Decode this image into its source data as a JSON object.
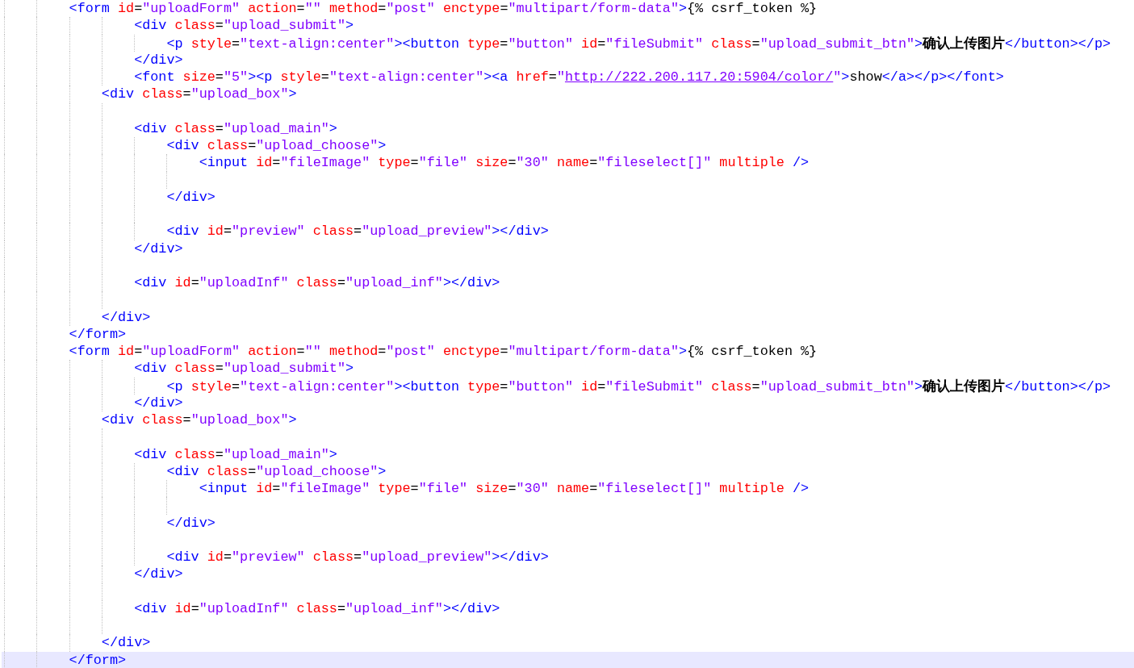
{
  "editor": {
    "lines": [
      {
        "children": [
          {
            "children": [
              {
                "current": false,
                "tokens": [
                  {
                    "kind": "tag",
                    "text": "<form"
                  },
                  {
                    "kind": "attr",
                    "text": " id"
                  },
                  {
                    "kind": "eq",
                    "text": "="
                  },
                  {
                    "kind": "value",
                    "text": "\"uploadForm\""
                  },
                  {
                    "kind": "attr",
                    "text": " action"
                  },
                  {
                    "kind": "eq",
                    "text": "="
                  },
                  {
                    "kind": "value",
                    "text": "\"\""
                  },
                  {
                    "kind": "attr",
                    "text": " method"
                  },
                  {
                    "kind": "eq",
                    "text": "="
                  },
                  {
                    "kind": "value",
                    "text": "\"post\""
                  },
                  {
                    "kind": "attr",
                    "text": " enctype"
                  },
                  {
                    "kind": "eq",
                    "text": "="
                  },
                  {
                    "kind": "value",
                    "text": "\"multipart/form-data\""
                  },
                  {
                    "kind": "tag",
                    "text": ">"
                  },
                  {
                    "kind": "text",
                    "text": "{% csrf_token %}"
                  }
                ],
                "children": [
                  {
                    "children": [
                      {
                        "current": false,
                        "tokens": [
                          {
                            "kind": "tag",
                            "text": "<div"
                          },
                          {
                            "kind": "attr",
                            "text": " class"
                          },
                          {
                            "kind": "eq",
                            "text": "="
                          },
                          {
                            "kind": "value",
                            "text": "\"upload_submit\""
                          },
                          {
                            "kind": "tag",
                            "text": ">"
                          }
                        ],
                        "children": [
                          {
                            "current": false,
                            "tokens": [
                              {
                                "kind": "tag",
                                "text": "<p"
                              },
                              {
                                "kind": "attr",
                                "text": " style"
                              },
                              {
                                "kind": "eq",
                                "text": "="
                              },
                              {
                                "kind": "value",
                                "text": "\"text-align:center\""
                              },
                              {
                                "kind": "tag",
                                "text": "><button"
                              },
                              {
                                "kind": "attr",
                                "text": " type"
                              },
                              {
                                "kind": "eq",
                                "text": "="
                              },
                              {
                                "kind": "value",
                                "text": "\"button\""
                              },
                              {
                                "kind": "attr",
                                "text": " id"
                              },
                              {
                                "kind": "eq",
                                "text": "="
                              },
                              {
                                "kind": "value",
                                "text": "\"fileSubmit\""
                              },
                              {
                                "kind": "attr",
                                "text": " class"
                              },
                              {
                                "kind": "eq",
                                "text": "="
                              },
                              {
                                "kind": "value",
                                "text": "\"upload_submit_btn\""
                              },
                              {
                                "kind": "tag",
                                "text": ">"
                              },
                              {
                                "kind": "cjk",
                                "text": "确认上传图片"
                              },
                              {
                                "kind": "tag",
                                "text": "</button></p>"
                              }
                            ]
                          }
                        ]
                      },
                      {
                        "current": false,
                        "tokens": [
                          {
                            "kind": "tag",
                            "text": "</div>"
                          }
                        ]
                      },
                      {
                        "current": false,
                        "tokens": [
                          {
                            "kind": "tag",
                            "text": "<font"
                          },
                          {
                            "kind": "attr",
                            "text": " size"
                          },
                          {
                            "kind": "eq",
                            "text": "="
                          },
                          {
                            "kind": "value",
                            "text": "\"5\""
                          },
                          {
                            "kind": "tag",
                            "text": "><p"
                          },
                          {
                            "kind": "attr",
                            "text": " style"
                          },
                          {
                            "kind": "eq",
                            "text": "="
                          },
                          {
                            "kind": "value",
                            "text": "\"text-align:center\""
                          },
                          {
                            "kind": "tag",
                            "text": "><a"
                          },
                          {
                            "kind": "attr",
                            "text": " href"
                          },
                          {
                            "kind": "eq",
                            "text": "="
                          },
                          {
                            "kind": "value",
                            "text": "\""
                          },
                          {
                            "kind": "link",
                            "text": "http://222.200.117.20:5904/color/"
                          },
                          {
                            "kind": "value",
                            "text": "\""
                          },
                          {
                            "kind": "tag",
                            "text": ">"
                          },
                          {
                            "kind": "text",
                            "text": "show"
                          },
                          {
                            "kind": "tag",
                            "text": "</a></p></font>"
                          }
                        ]
                      }
                    ]
                  },
                  {
                    "current": false,
                    "tokens": [
                      {
                        "kind": "tag",
                        "text": "<div"
                      },
                      {
                        "kind": "attr",
                        "text": " class"
                      },
                      {
                        "kind": "eq",
                        "text": "="
                      },
                      {
                        "kind": "value",
                        "text": "\"upload_box\""
                      },
                      {
                        "kind": "tag",
                        "text": ">"
                      }
                    ],
                    "children": [
                      {
                        "current": false
                      },
                      {
                        "current": false,
                        "tokens": [
                          {
                            "kind": "tag",
                            "text": "<div"
                          },
                          {
                            "kind": "attr",
                            "text": " class"
                          },
                          {
                            "kind": "eq",
                            "text": "="
                          },
                          {
                            "kind": "value",
                            "text": "\"upload_main\""
                          },
                          {
                            "kind": "tag",
                            "text": ">"
                          }
                        ],
                        "children": [
                          {
                            "current": false,
                            "tokens": [
                              {
                                "kind": "tag",
                                "text": "<div"
                              },
                              {
                                "kind": "attr",
                                "text": " class"
                              },
                              {
                                "kind": "eq",
                                "text": "="
                              },
                              {
                                "kind": "value",
                                "text": "\"upload_choose\""
                              },
                              {
                                "kind": "tag",
                                "text": ">"
                              }
                            ],
                            "children": [
                              {
                                "current": false,
                                "tokens": [
                                  {
                                    "kind": "tag",
                                    "text": "<input"
                                  },
                                  {
                                    "kind": "attr",
                                    "text": " id"
                                  },
                                  {
                                    "kind": "eq",
                                    "text": "="
                                  },
                                  {
                                    "kind": "value",
                                    "text": "\"fileImage\""
                                  },
                                  {
                                    "kind": "attr",
                                    "text": " type"
                                  },
                                  {
                                    "kind": "eq",
                                    "text": "="
                                  },
                                  {
                                    "kind": "value",
                                    "text": "\"file\""
                                  },
                                  {
                                    "kind": "attr",
                                    "text": " size"
                                  },
                                  {
                                    "kind": "eq",
                                    "text": "="
                                  },
                                  {
                                    "kind": "value",
                                    "text": "\"30\""
                                  },
                                  {
                                    "kind": "attr",
                                    "text": " name"
                                  },
                                  {
                                    "kind": "eq",
                                    "text": "="
                                  },
                                  {
                                    "kind": "value",
                                    "text": "\"fileselect[]\""
                                  },
                                  {
                                    "kind": "attr",
                                    "text": " multiple"
                                  },
                                  {
                                    "kind": "tag",
                                    "text": " />"
                                  }
                                ]
                              },
                              {
                                "current": false
                              }
                            ]
                          },
                          {
                            "current": false,
                            "tokens": [
                              {
                                "kind": "tag",
                                "text": "</div>"
                              }
                            ]
                          },
                          {
                            "current": false
                          },
                          {
                            "current": false,
                            "tokens": [
                              {
                                "kind": "tag",
                                "text": "<div"
                              },
                              {
                                "kind": "attr",
                                "text": " id"
                              },
                              {
                                "kind": "eq",
                                "text": "="
                              },
                              {
                                "kind": "value",
                                "text": "\"preview\""
                              },
                              {
                                "kind": "attr",
                                "text": " class"
                              },
                              {
                                "kind": "eq",
                                "text": "="
                              },
                              {
                                "kind": "value",
                                "text": "\"upload_preview\""
                              },
                              {
                                "kind": "tag",
                                "text": "></div>"
                              }
                            ]
                          }
                        ]
                      },
                      {
                        "current": false,
                        "tokens": [
                          {
                            "kind": "tag",
                            "text": "</div>"
                          }
                        ]
                      },
                      {
                        "current": false
                      },
                      {
                        "current": false,
                        "tokens": [
                          {
                            "kind": "tag",
                            "text": "<div"
                          },
                          {
                            "kind": "attr",
                            "text": " id"
                          },
                          {
                            "kind": "eq",
                            "text": "="
                          },
                          {
                            "kind": "value",
                            "text": "\"uploadInf\""
                          },
                          {
                            "kind": "attr",
                            "text": " class"
                          },
                          {
                            "kind": "eq",
                            "text": "="
                          },
                          {
                            "kind": "value",
                            "text": "\"upload_inf\""
                          },
                          {
                            "kind": "tag",
                            "text": "></div>"
                          }
                        ]
                      },
                      {
                        "current": false
                      }
                    ]
                  },
                  {
                    "current": false,
                    "tokens": [
                      {
                        "kind": "tag",
                        "text": "</div>"
                      }
                    ]
                  }
                ]
              },
              {
                "current": false,
                "tokens": [
                  {
                    "kind": "tag",
                    "text": "</form>"
                  }
                ]
              },
              {
                "current": false,
                "tokens": [
                  {
                    "kind": "tag",
                    "text": "<form"
                  },
                  {
                    "kind": "attr",
                    "text": " id"
                  },
                  {
                    "kind": "eq",
                    "text": "="
                  },
                  {
                    "kind": "value",
                    "text": "\"uploadForm\""
                  },
                  {
                    "kind": "attr",
                    "text": " action"
                  },
                  {
                    "kind": "eq",
                    "text": "="
                  },
                  {
                    "kind": "value",
                    "text": "\"\""
                  },
                  {
                    "kind": "attr",
                    "text": " method"
                  },
                  {
                    "kind": "eq",
                    "text": "="
                  },
                  {
                    "kind": "value",
                    "text": "\"post\""
                  },
                  {
                    "kind": "attr",
                    "text": " enctype"
                  },
                  {
                    "kind": "eq",
                    "text": "="
                  },
                  {
                    "kind": "value",
                    "text": "\"multipart/form-data\""
                  },
                  {
                    "kind": "tag",
                    "text": ">"
                  },
                  {
                    "kind": "text",
                    "text": "{% csrf_token %}"
                  }
                ],
                "children": [
                  {
                    "children": [
                      {
                        "current": false,
                        "tokens": [
                          {
                            "kind": "tag",
                            "text": "<div"
                          },
                          {
                            "kind": "attr",
                            "text": " class"
                          },
                          {
                            "kind": "eq",
                            "text": "="
                          },
                          {
                            "kind": "value",
                            "text": "\"upload_submit\""
                          },
                          {
                            "kind": "tag",
                            "text": ">"
                          }
                        ],
                        "children": [
                          {
                            "current": false,
                            "tokens": [
                              {
                                "kind": "tag",
                                "text": "<p"
                              },
                              {
                                "kind": "attr",
                                "text": " style"
                              },
                              {
                                "kind": "eq",
                                "text": "="
                              },
                              {
                                "kind": "value",
                                "text": "\"text-align:center\""
                              },
                              {
                                "kind": "tag",
                                "text": "><button"
                              },
                              {
                                "kind": "attr",
                                "text": " type"
                              },
                              {
                                "kind": "eq",
                                "text": "="
                              },
                              {
                                "kind": "value",
                                "text": "\"button\""
                              },
                              {
                                "kind": "attr",
                                "text": " id"
                              },
                              {
                                "kind": "eq",
                                "text": "="
                              },
                              {
                                "kind": "value",
                                "text": "\"fileSubmit\""
                              },
                              {
                                "kind": "attr",
                                "text": " class"
                              },
                              {
                                "kind": "eq",
                                "text": "="
                              },
                              {
                                "kind": "value",
                                "text": "\"upload_submit_btn\""
                              },
                              {
                                "kind": "tag",
                                "text": ">"
                              },
                              {
                                "kind": "cjk",
                                "text": "确认上传图片"
                              },
                              {
                                "kind": "tag",
                                "text": "</button></p>"
                              }
                            ]
                          }
                        ]
                      },
                      {
                        "current": false,
                        "tokens": [
                          {
                            "kind": "tag",
                            "text": "</div>"
                          }
                        ]
                      }
                    ]
                  },
                  {
                    "current": false,
                    "tokens": [
                      {
                        "kind": "tag",
                        "text": "<div"
                      },
                      {
                        "kind": "attr",
                        "text": " class"
                      },
                      {
                        "kind": "eq",
                        "text": "="
                      },
                      {
                        "kind": "value",
                        "text": "\"upload_box\""
                      },
                      {
                        "kind": "tag",
                        "text": ">"
                      }
                    ],
                    "children": [
                      {
                        "current": false
                      },
                      {
                        "current": false,
                        "tokens": [
                          {
                            "kind": "tag",
                            "text": "<div"
                          },
                          {
                            "kind": "attr",
                            "text": " class"
                          },
                          {
                            "kind": "eq",
                            "text": "="
                          },
                          {
                            "kind": "value",
                            "text": "\"upload_main\""
                          },
                          {
                            "kind": "tag",
                            "text": ">"
                          }
                        ],
                        "children": [
                          {
                            "current": false,
                            "tokens": [
                              {
                                "kind": "tag",
                                "text": "<div"
                              },
                              {
                                "kind": "attr",
                                "text": " class"
                              },
                              {
                                "kind": "eq",
                                "text": "="
                              },
                              {
                                "kind": "value",
                                "text": "\"upload_choose\""
                              },
                              {
                                "kind": "tag",
                                "text": ">"
                              }
                            ],
                            "children": [
                              {
                                "current": false,
                                "tokens": [
                                  {
                                    "kind": "tag",
                                    "text": "<input"
                                  },
                                  {
                                    "kind": "attr",
                                    "text": " id"
                                  },
                                  {
                                    "kind": "eq",
                                    "text": "="
                                  },
                                  {
                                    "kind": "value",
                                    "text": "\"fileImage\""
                                  },
                                  {
                                    "kind": "attr",
                                    "text": " type"
                                  },
                                  {
                                    "kind": "eq",
                                    "text": "="
                                  },
                                  {
                                    "kind": "value",
                                    "text": "\"file\""
                                  },
                                  {
                                    "kind": "attr",
                                    "text": " size"
                                  },
                                  {
                                    "kind": "eq",
                                    "text": "="
                                  },
                                  {
                                    "kind": "value",
                                    "text": "\"30\""
                                  },
                                  {
                                    "kind": "attr",
                                    "text": " name"
                                  },
                                  {
                                    "kind": "eq",
                                    "text": "="
                                  },
                                  {
                                    "kind": "value",
                                    "text": "\"fileselect[]\""
                                  },
                                  {
                                    "kind": "attr",
                                    "text": " multiple"
                                  },
                                  {
                                    "kind": "tag",
                                    "text": " />"
                                  }
                                ]
                              },
                              {
                                "current": false
                              }
                            ]
                          },
                          {
                            "current": false,
                            "tokens": [
                              {
                                "kind": "tag",
                                "text": "</div>"
                              }
                            ]
                          },
                          {
                            "current": false
                          },
                          {
                            "current": false,
                            "tokens": [
                              {
                                "kind": "tag",
                                "text": "<div"
                              },
                              {
                                "kind": "attr",
                                "text": " id"
                              },
                              {
                                "kind": "eq",
                                "text": "="
                              },
                              {
                                "kind": "value",
                                "text": "\"preview\""
                              },
                              {
                                "kind": "attr",
                                "text": " class"
                              },
                              {
                                "kind": "eq",
                                "text": "="
                              },
                              {
                                "kind": "value",
                                "text": "\"upload_preview\""
                              },
                              {
                                "kind": "tag",
                                "text": "></div>"
                              }
                            ]
                          }
                        ]
                      },
                      {
                        "current": false,
                        "tokens": [
                          {
                            "kind": "tag",
                            "text": "</div>"
                          }
                        ]
                      },
                      {
                        "current": false
                      },
                      {
                        "current": false,
                        "tokens": [
                          {
                            "kind": "tag",
                            "text": "<div"
                          },
                          {
                            "kind": "attr",
                            "text": " id"
                          },
                          {
                            "kind": "eq",
                            "text": "="
                          },
                          {
                            "kind": "value",
                            "text": "\"uploadInf\""
                          },
                          {
                            "kind": "attr",
                            "text": " class"
                          },
                          {
                            "kind": "eq",
                            "text": "="
                          },
                          {
                            "kind": "value",
                            "text": "\"upload_inf\""
                          },
                          {
                            "kind": "tag",
                            "text": "></div>"
                          }
                        ]
                      },
                      {
                        "current": false
                      }
                    ]
                  },
                  {
                    "current": false,
                    "tokens": [
                      {
                        "kind": "tag",
                        "text": "</div>"
                      }
                    ]
                  }
                ]
              },
              {
                "current": true,
                "tokens": [
                  {
                    "kind": "tag",
                    "text": "</form>"
                  }
                ]
              }
            ]
          }
        ]
      }
    ]
  }
}
